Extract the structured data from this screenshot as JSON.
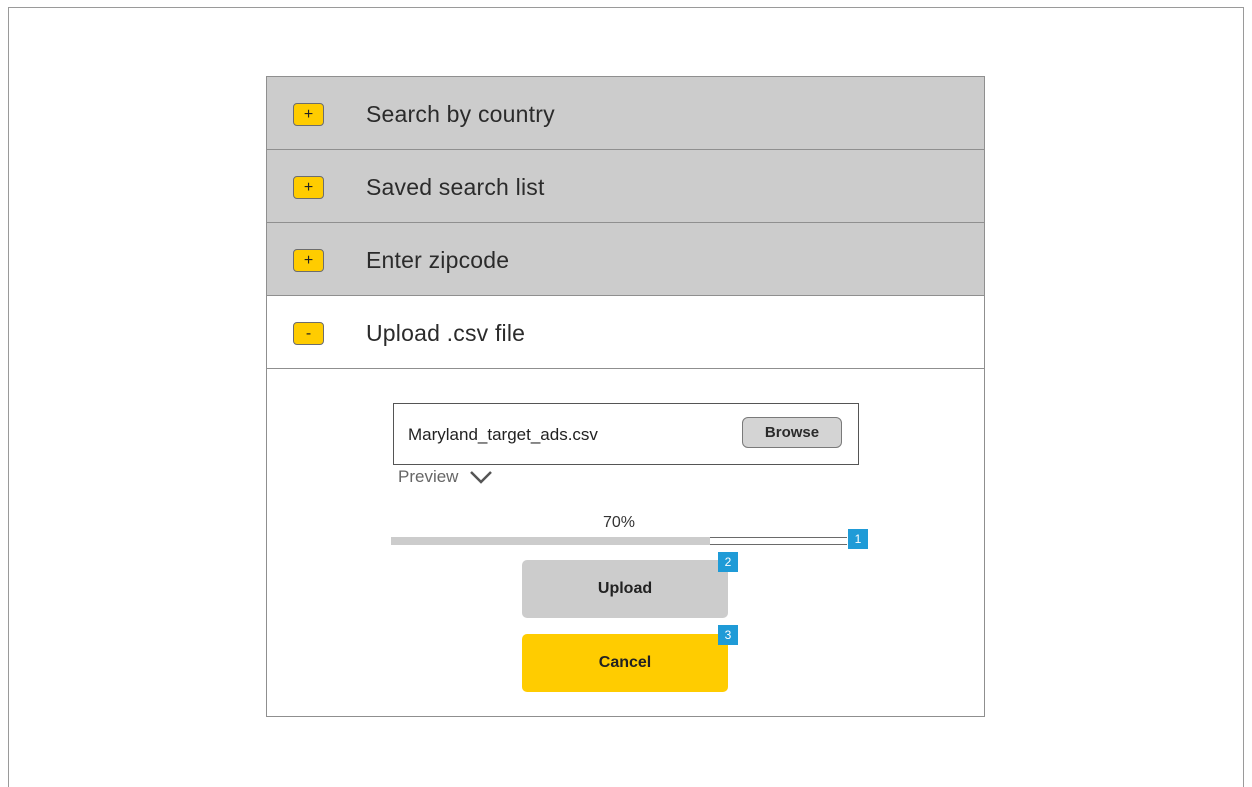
{
  "accordion": {
    "items": [
      {
        "toggle": "+",
        "label": "Search by country",
        "state": "collapsed"
      },
      {
        "toggle": "+",
        "label": "Saved search list",
        "state": "collapsed"
      },
      {
        "toggle": "+",
        "label": "Enter zipcode",
        "state": "collapsed"
      },
      {
        "toggle": "-",
        "label": "Upload .csv file",
        "state": "expanded"
      }
    ]
  },
  "upload": {
    "file_name": "Maryland_target_ads.csv",
    "browse_label": "Browse",
    "preview_label": "Preview",
    "progress_text": "70%",
    "progress_value": 0.7,
    "upload_label": "Upload",
    "cancel_label": "Cancel"
  },
  "markers": [
    "1",
    "2",
    "3"
  ],
  "colors": {
    "accent": "#ffcc00",
    "collapsed_bg": "#cccccc",
    "marker": "#1f9bd7"
  },
  "icons": {
    "preview_toggle": "chevron-down-icon"
  }
}
